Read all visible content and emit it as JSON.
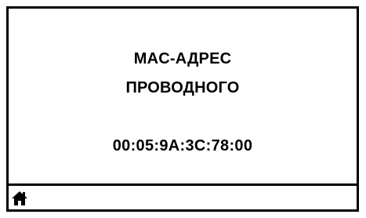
{
  "screen": {
    "title_line_1": "MAC-АДРЕС",
    "title_line_2": "ПРОВОДНОГО",
    "mac_address": "00:05:9A:3C:78:00"
  },
  "footer": {
    "home_icon": "home-icon"
  },
  "colors": {
    "foreground": "#000000",
    "background": "#ffffff"
  }
}
